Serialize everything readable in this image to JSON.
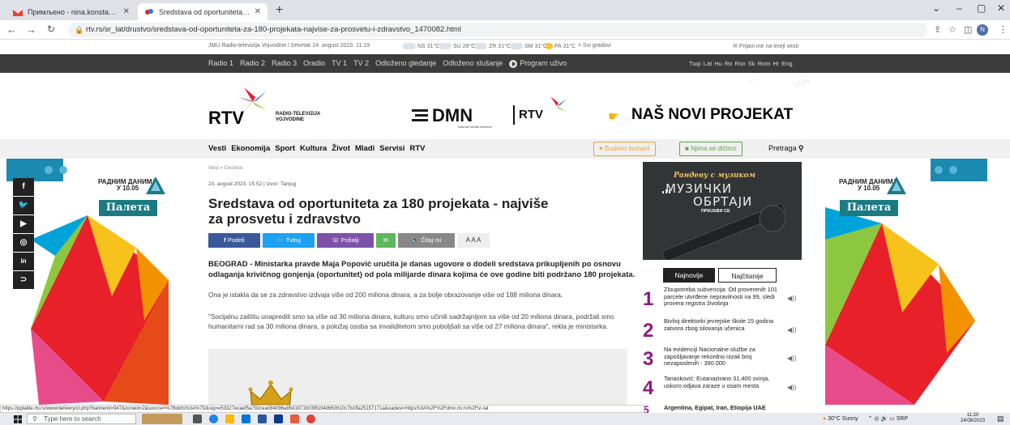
{
  "browser": {
    "tabs": [
      {
        "label": "Примљено - nina.konstantinidis",
        "active": false
      },
      {
        "label": "Sredstava od oportuniteta za 180",
        "active": true
      }
    ],
    "url": "rtv.rs/sr_lat/drustvo/sredstava-od-oportuniteta-za-180-projekata-najvise-za-prosvetu-i-zdravstvo_1470082.html",
    "profile_initial": "N"
  },
  "topinfo": {
    "date": "JMU Radio-televizija Vojvodine / četvrtak 24. avgust 2023. 11.19",
    "weather": [
      {
        "city": "NS",
        "temp": "31°C"
      },
      {
        "city": "SU",
        "temp": "28°C"
      },
      {
        "city": "ZR",
        "temp": "31°C"
      },
      {
        "city": "SM",
        "temp": "31°C"
      },
      {
        "city": "PA",
        "temp": "31°C"
      }
    ],
    "all_cities": "> Svi gradovi",
    "newsletter": "Prijavi me na imejl vesti"
  },
  "darknav": {
    "items": [
      "Radio 1",
      "Radio 2",
      "Radio 3",
      "Oradio",
      "TV 1",
      "TV 2",
      "Odloženo gledanje",
      "Odloženo slušanje"
    ],
    "live": "Program uživo",
    "langs": [
      "Тшр",
      "Lat",
      "Hu",
      "Ro",
      "Rsn",
      "Sk",
      "Rom",
      "Hr",
      "Eng"
    ]
  },
  "header": {
    "rtv_logo": "RTV",
    "rtv_sub_1": "RADIO-TELEVIZIJA",
    "rtv_sub_2": "VOJVODINE",
    "dmn": "DMN",
    "dmn_sub": "Danube Media Network",
    "rtv_small": "RTV",
    "project": "NAŠ NOVI PROJEKAT"
  },
  "mainnav": {
    "items": [
      "Vesti",
      "Ekonomija",
      "Sport",
      "Kultura",
      "Život",
      "Mladi",
      "Servisi",
      "RTV"
    ],
    "budimo": "Budimo humani",
    "njima": "Njima se dičimo",
    "search": "Pretraga"
  },
  "banner": {
    "radnim_1": "РАДНИМ ДАНИМА",
    "radnim_2": "У 10.05",
    "paleta": "Палета"
  },
  "article": {
    "breadcrumb": "Vest » Društvo",
    "meta": "23. avgust 2023. 15.52 | Izvor: Tanjug",
    "title": "Sredstava od oportuniteta za 180 projekata - najviše za prosvetu i zdravstvo",
    "share": {
      "facebook": "Podeli",
      "twitter": "Tvituj",
      "viber": "Pošalji",
      "read": "Čitaj mi",
      "fontsize": "A A A"
    },
    "lead": "BEOGRAD - Ministarka pravde Maja Popović uručila je danas ugovore o dodeli sredstava prikupljenih po osnovu odlaganja krivičnog gonjenja (oportunitet) od pola milijarde dinara kojima će ove godine biti podržano 180 projekata.",
    "para1": "Ona je istakla da se za zdravstvo izdvaja više od 200 miliona dinara, a za bolje obrazovanje više od 188 miliona dinara.",
    "para2": "\"Socijalnu zaštitu unapredili smo sa više od 30 miliona dinara, kulturu smo učinili sadržajnijom sa više od 20 miliona dinara, podržali smo humanitarni rad sa 30 miliona dinara, a položaj osoba sa invaliditetom smo poboljšali sa više od 27 miliona dinara\", rekla je ministarka."
  },
  "ad": {
    "line1": "Рандеву с музиком",
    "line2": "МУЗИЧКИ",
    "line3": "ОБРТАЈИ",
    "cta": "ПРИЈАВИ СЕ"
  },
  "newstabs": {
    "latest": "Najnovije",
    "mostread": "Najčitanije"
  },
  "news": [
    {
      "num": "1",
      "text": "Zloupotreba subvencija: Od proverenih 101 parcele utvrđene nepravilnosti na 99, sledi provera registra životinja"
    },
    {
      "num": "2",
      "text": "Bivšoj direktorki jevrejske škole 15 godina zatvora zbog silovanja učenica"
    },
    {
      "num": "3",
      "text": "Na evidenciji Nacionalne službe za zapošljavanje rekordno nizak broj nezaposlenih - 390.000"
    },
    {
      "num": "4",
      "text": "Tanasković: Eutanazirano 31.400 svinja, uskoro odjava zaraze u osam mesta"
    },
    {
      "num": "5",
      "text": "Argentina, Egipat, Iran, Etiopija UAE"
    }
  ],
  "statusbar": "https://pptable.rtv.rs/www/delivery/cl.php?bannerid=947&zoneid=2&source=%7Bobfs%3A%7D&sig=e53327ecaef5a792cea084096a9541871b03f6194d663610c7b1ffa25157171a&oadest=https%3A%2F%2Fdmn.rtv.rs%2Fsr-lat",
  "taskbar": {
    "search_placeholder": "Type here to search",
    "weather": "30°C  Sunny",
    "lang": "SRP",
    "time": "11:20",
    "date": "24/08/2023"
  },
  "colors": {
    "accent": "#8a1a84",
    "dark_nav": "#3b3b3b",
    "facebook": "#3b5998",
    "twitter": "#1da1f2",
    "viber": "#7d52a8",
    "email": "#5cb85c",
    "read": "#888888"
  }
}
